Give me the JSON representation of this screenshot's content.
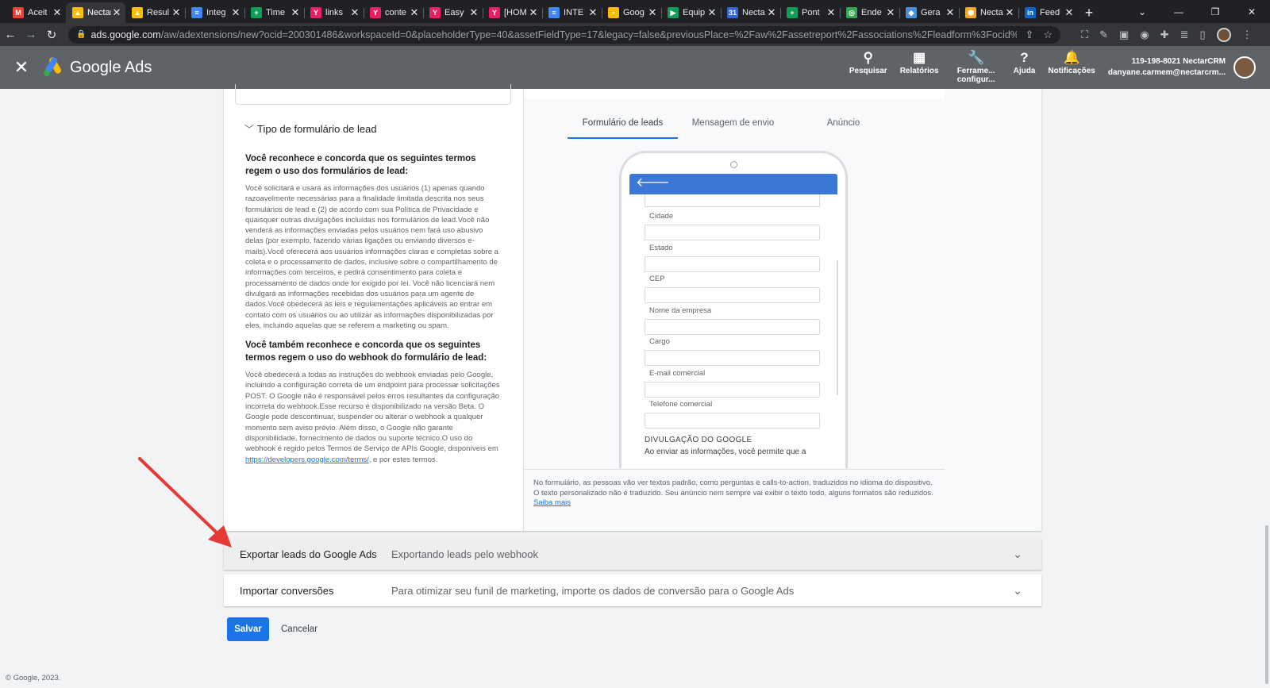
{
  "browser": {
    "tabs": [
      {
        "title": "Aceit",
        "icon_color": "#ea4335",
        "icon_char": "M"
      },
      {
        "title": "Nectar",
        "icon_color": "#fbbc04",
        "icon_char": "▲",
        "active": true
      },
      {
        "title": "Resul",
        "icon_color": "#fbbc04",
        "icon_char": "▲"
      },
      {
        "title": "Integ",
        "icon_color": "#4285f4",
        "icon_char": "≡"
      },
      {
        "title": "Time",
        "icon_color": "#0f9d58",
        "icon_char": "+"
      },
      {
        "title": "links",
        "icon_color": "#e91e63",
        "icon_char": "Y"
      },
      {
        "title": "conte",
        "icon_color": "#e91e63",
        "icon_char": "Y"
      },
      {
        "title": "Easy",
        "icon_color": "#e91e63",
        "icon_char": "Y"
      },
      {
        "title": "[HOM",
        "icon_color": "#e91e63",
        "icon_char": "Y"
      },
      {
        "title": "INTE",
        "icon_color": "#4285f4",
        "icon_char": "≡"
      },
      {
        "title": "Goog",
        "icon_color": "#fbbc04",
        "icon_char": "▪"
      },
      {
        "title": "Equip",
        "icon_color": "#0f9d58",
        "icon_char": "▶"
      },
      {
        "title": "Necta",
        "icon_color": "#3367d6",
        "icon_char": "31"
      },
      {
        "title": "Pont",
        "icon_color": "#0f9d58",
        "icon_char": "+"
      },
      {
        "title": "Ende",
        "icon_color": "#34a853",
        "icon_char": "◎"
      },
      {
        "title": "Gera",
        "icon_color": "#4a90d9",
        "icon_char": "◆"
      },
      {
        "title": "Necta",
        "icon_color": "#f5a623",
        "icon_char": "⬢"
      },
      {
        "title": "Feed",
        "icon_color": "#0a66c2",
        "icon_char": "in"
      }
    ],
    "url_host": "ads.google.com",
    "url_path": "/aw/adextensions/new?ocid=200301486&workspaceId=0&placeholderType=40&assetFieldType=17&legacy=false&previousPlace=%2Faw%2Fassetreport%2Fassociations%2Fleadform%3Focid%3D200301486%2..."
  },
  "header": {
    "brand": "Google Ads",
    "actions": [
      {
        "icon": "search-icon",
        "glyph": "⚲",
        "label": "Pesquisar"
      },
      {
        "icon": "reports-icon",
        "glyph": "▦",
        "label": "Relatórios"
      },
      {
        "icon": "tools-icon",
        "glyph": "🔧",
        "label": "Ferrame... configur..."
      },
      {
        "icon": "help-icon",
        "glyph": "?",
        "label": "Ajuda"
      },
      {
        "icon": "bell-icon",
        "glyph": "🔔",
        "label": "Notificações"
      }
    ],
    "account_id": "119-198-8021 NectarCRM",
    "account_email": "danyane.carmem@nectarcrm..."
  },
  "form": {
    "section_title": "Tipo de formulário de lead",
    "terms1_heading": "Você reconhece e concorda que os seguintes termos regem o uso dos formulários de lead:",
    "terms1_body": "Você solicitará e usará as informações dos usuários (1) apenas quando razoavelmente necessárias para a finalidade limitada descrita nos seus formulários de lead e (2) de acordo com sua Política de Privacidade e quaisquer outras divulgações incluídas nos formulários de lead.Você não venderá as informações enviadas pelos usuários nem fará uso abusivo delas (por exemplo, fazendo várias ligações ou enviando diversos e-mails).Você oferecerá aos usuários informações claras e completas sobre a coleta e o processamento de dados, inclusive sobre o compartilhamento de informações com terceiros, e pedirá consentimento para coleta e processamento de dados onde for exigido por lei. Você não licenciará nem divulgará as informações recebidas dos usuários para um agente de dados.Você obedecerá às leis e regulamentações aplicáveis ao entrar em contato com os usuários ou ao utilizar as informações disponibilizadas por eles, incluindo aquelas que se referem a marketing ou spam.",
    "terms2_heading": "Você também reconhece e concorda que os seguintes termos regem o uso do webhook do formulário de lead:",
    "terms2_body": "Você obedecerá a todas as instruções do webhook enviadas pelo Google, incluindo a configuração correta de um endpoint para processar solicitações POST. O Google não é responsável pelos erros resultantes da configuração incorreta do webhook.Esse recurso é disponibilizado na versão Beta. O Google pode descontinuar, suspender ou alterar o webhook a qualquer momento sem aviso prévio. Além disso, o Google não garante disponibilidade, fornecimento de dados ou suporte técnico.O uso do webhook é regido pelos Termos de Serviço de APIs Google, disponíveis em",
    "terms2_link": "https://developers.google.com/terms/",
    "terms2_tail": ", e por estes termos."
  },
  "preview": {
    "tabs": [
      "Formulário de leads",
      "Mensagem de envio",
      "Anúncio"
    ],
    "fields": [
      "Cidade",
      "Estado",
      "CEP",
      "Nome da empresa",
      "Cargo",
      "E-mail comercial",
      "Telefone comercial"
    ],
    "disclosure_heading": "DIVULGAÇÃO DO GOOGLE",
    "disclosure_text": "Ao enviar as informações, você permite que a",
    "note": "No formulário, as pessoas vão ver textos padrão, como perguntas e calls-to-action, traduzidos no idioma do dispositivo. O texto personalizado não é traduzido. Seu anúncio nem sempre vai exibir o texto todo, alguns formatos são reduzidos.",
    "note_link": "Saiba mais"
  },
  "sections": [
    {
      "name": "Exportar leads do Google Ads",
      "desc": "Exportando leads pelo webhook"
    },
    {
      "name": "Importar conversões",
      "desc": "Para otimizar seu funil de marketing, importe os dados de conversão para o Google Ads"
    }
  ],
  "buttons": {
    "save": "Salvar",
    "cancel": "Cancelar"
  },
  "footer": "© Google, 2023.",
  "colors": {
    "primary": "#1a73e8",
    "header_bg": "#5f6368",
    "annotation_arrow": "#e53935"
  }
}
